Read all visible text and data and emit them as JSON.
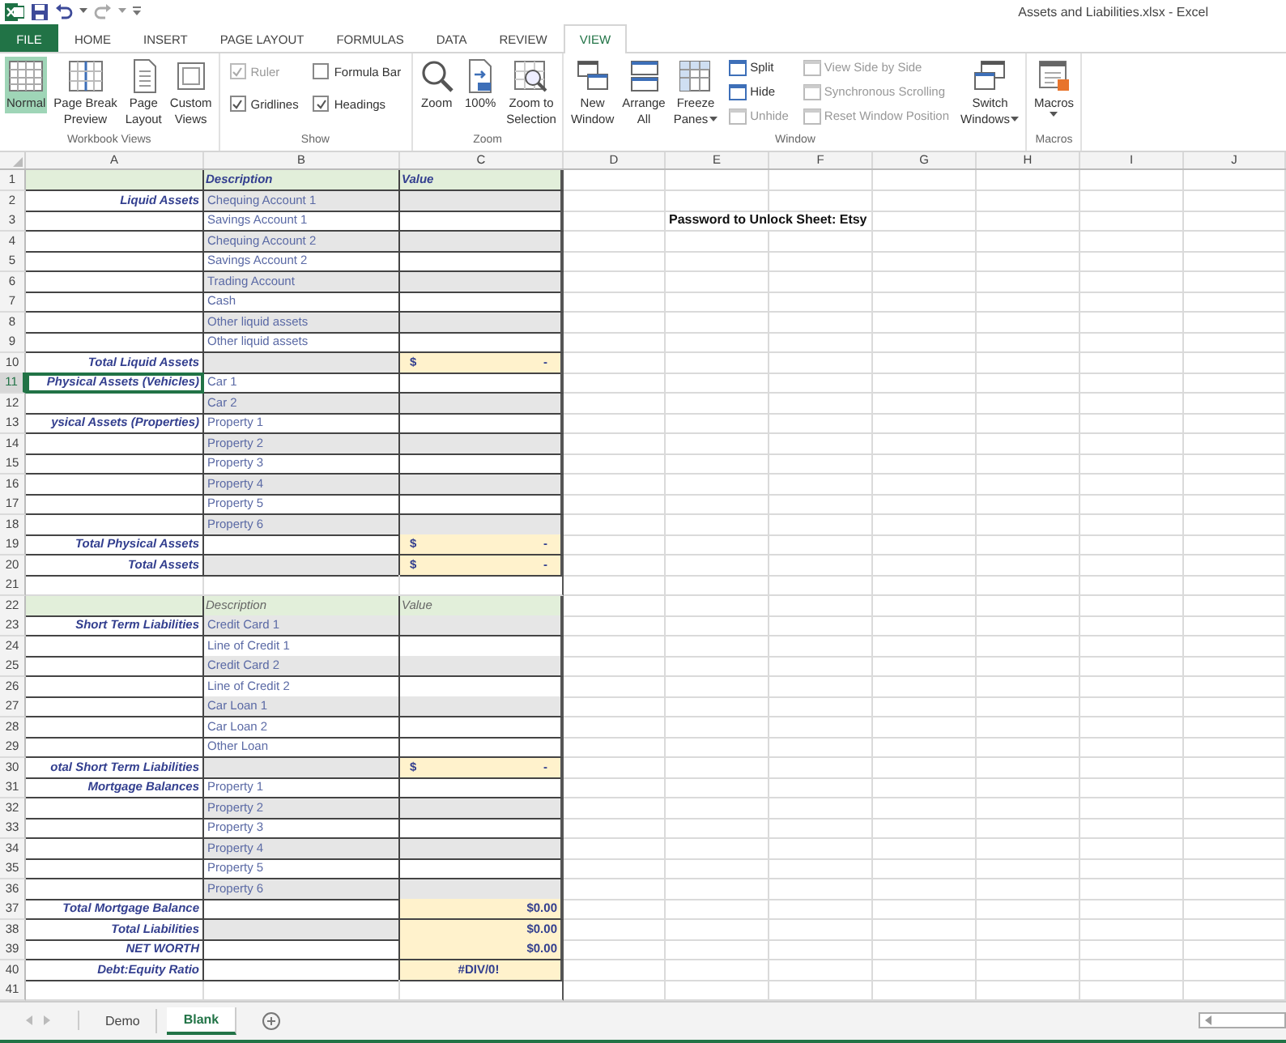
{
  "window": {
    "title": "Assets and Liabilities.xlsx - Excel"
  },
  "tabs": [
    {
      "label": "FILE",
      "kind": "file",
      "selected": false
    },
    {
      "label": "HOME",
      "kind": "tab",
      "selected": false
    },
    {
      "label": "INSERT",
      "kind": "tab",
      "selected": false
    },
    {
      "label": "PAGE LAYOUT",
      "kind": "tab",
      "selected": false
    },
    {
      "label": "FORMULAS",
      "kind": "tab",
      "selected": false
    },
    {
      "label": "DATA",
      "kind": "tab",
      "selected": false
    },
    {
      "label": "REVIEW",
      "kind": "tab",
      "selected": false
    },
    {
      "label": "VIEW",
      "kind": "tab",
      "selected": true
    }
  ],
  "ribbon": {
    "groups": [
      {
        "label": "Workbook Views",
        "items": [
          {
            "kind": "large",
            "lines": [
              "Normal"
            ],
            "selected": true
          },
          {
            "kind": "large",
            "lines": [
              "Page Break",
              "Preview"
            ],
            "selected": false
          },
          {
            "kind": "large",
            "lines": [
              "Page",
              "Layout"
            ],
            "selected": false
          },
          {
            "kind": "large",
            "lines": [
              "Custom",
              "Views"
            ],
            "selected": false
          }
        ]
      },
      {
        "label": "Show",
        "items": [
          {
            "kind": "column",
            "items": [
              {
                "kind": "checkbox",
                "label": "Ruler",
                "checked": true,
                "disabled": true
              },
              {
                "kind": "checkbox",
                "label": "Gridlines",
                "checked": true,
                "disabled": false
              }
            ]
          },
          {
            "kind": "column",
            "items": [
              {
                "kind": "checkbox",
                "label": "Formula Bar",
                "checked": false,
                "disabled": false
              },
              {
                "kind": "checkbox",
                "label": "Headings",
                "checked": true,
                "disabled": false
              }
            ]
          }
        ]
      },
      {
        "label": "Zoom",
        "items": [
          {
            "kind": "large",
            "lines": [
              "Zoom"
            ]
          },
          {
            "kind": "large",
            "lines": [
              "100%"
            ]
          },
          {
            "kind": "large",
            "lines": [
              "Zoom to",
              "Selection"
            ]
          }
        ]
      },
      {
        "label": "Window",
        "items": [
          {
            "kind": "large",
            "lines": [
              "New",
              "Window"
            ]
          },
          {
            "kind": "large",
            "lines": [
              "Arrange",
              "All"
            ]
          },
          {
            "kind": "large",
            "lines": [
              "Freeze",
              "Panes"
            ],
            "dropdown": true
          },
          {
            "kind": "column",
            "items": [
              {
                "kind": "small",
                "label": "Split",
                "disabled": false
              },
              {
                "kind": "small",
                "label": "Hide",
                "disabled": false
              },
              {
                "kind": "small",
                "label": "Unhide",
                "disabled": true
              }
            ]
          },
          {
            "kind": "column",
            "items": [
              {
                "kind": "small",
                "label": "View Side by Side",
                "disabled": true
              },
              {
                "kind": "small",
                "label": "Synchronous Scrolling",
                "disabled": true
              },
              {
                "kind": "small",
                "label": "Reset Window Position",
                "disabled": true
              }
            ]
          },
          {
            "kind": "large",
            "lines": [
              "Switch",
              "Windows"
            ],
            "dropdown": true
          }
        ]
      },
      {
        "label": "Macros",
        "items": [
          {
            "kind": "large",
            "lines": [
              "Macros"
            ],
            "dropdown": true
          }
        ]
      }
    ]
  },
  "columns": [
    "A",
    "B",
    "C",
    "D",
    "E",
    "F",
    "G",
    "H",
    "I",
    "J"
  ],
  "rows": [
    {
      "number": "1",
      "kind": "header",
      "description": "Description",
      "value": "Value",
      "selected": false
    },
    {
      "number": "2",
      "kind": "item",
      "label": "Liquid Assets",
      "description": "Chequing Account 1",
      "shaded": true,
      "selected": false
    },
    {
      "number": "3",
      "kind": "item",
      "description": "Savings Account 1",
      "shaded": false,
      "note": "Password to Unlock Sheet: Etsy",
      "selected": false
    },
    {
      "number": "4",
      "kind": "item",
      "description": "Chequing Account 2",
      "shaded": true,
      "selected": false
    },
    {
      "number": "5",
      "kind": "item",
      "description": "Savings Account 2",
      "shaded": false,
      "selected": false
    },
    {
      "number": "6",
      "kind": "item",
      "description": "Trading Account",
      "shaded": true,
      "selected": false
    },
    {
      "number": "7",
      "kind": "item",
      "description": "Cash",
      "shaded": false,
      "selected": false
    },
    {
      "number": "8",
      "kind": "item",
      "description": "Other liquid assets",
      "shaded": true,
      "selected": false
    },
    {
      "number": "9",
      "kind": "item",
      "description": "Other liquid assets",
      "shaded": false,
      "selected": false
    },
    {
      "number": "10",
      "kind": "total",
      "label": "Total Liquid Assets",
      "symbol": "$",
      "value": "-",
      "shaded": true,
      "selected": false
    },
    {
      "number": "11",
      "kind": "item",
      "label": "Physical Assets (Vehicles)",
      "description": "Car 1",
      "shaded": false,
      "selected": true
    },
    {
      "number": "12",
      "kind": "item",
      "description": "Car 2",
      "shaded": true,
      "selected": false
    },
    {
      "number": "13",
      "kind": "item",
      "label": "ysical Assets (Properties)",
      "description": "Property 1",
      "shaded": false,
      "selected": false
    },
    {
      "number": "14",
      "kind": "item",
      "description": "Property 2",
      "shaded": true,
      "selected": false
    },
    {
      "number": "15",
      "kind": "item",
      "description": "Property 3",
      "shaded": false,
      "selected": false
    },
    {
      "number": "16",
      "kind": "item",
      "description": "Property 4",
      "shaded": true,
      "selected": false
    },
    {
      "number": "17",
      "kind": "item",
      "description": "Property 5",
      "shaded": false,
      "selected": false
    },
    {
      "number": "18",
      "kind": "item",
      "description": "Property 6",
      "shaded": true,
      "selected": false
    },
    {
      "number": "19",
      "kind": "total",
      "label": "Total Physical Assets",
      "symbol": "$",
      "value": "-",
      "shaded": false,
      "selected": false
    },
    {
      "number": "20",
      "kind": "total",
      "label": "Total Assets",
      "symbol": "$",
      "value": "-",
      "shaded": true,
      "selected": false
    },
    {
      "number": "21",
      "kind": "blank",
      "selected": false
    },
    {
      "number": "22",
      "kind": "subheader",
      "description": "Description",
      "value": "Value",
      "selected": false
    },
    {
      "number": "23",
      "kind": "item",
      "label": "Short Term Liabilities",
      "description": "Credit Card 1",
      "shaded": true,
      "selected": false
    },
    {
      "number": "24",
      "kind": "item",
      "description": "Line of Credit 1",
      "shaded": false,
      "selected": false
    },
    {
      "number": "25",
      "kind": "item",
      "description": "Credit Card 2",
      "shaded": true,
      "selected": false
    },
    {
      "number": "26",
      "kind": "item",
      "description": "Line of Credit 2",
      "shaded": false,
      "selected": false
    },
    {
      "number": "27",
      "kind": "item",
      "description": "Car Loan 1",
      "shaded": true,
      "selected": false
    },
    {
      "number": "28",
      "kind": "item",
      "description": "Car Loan 2",
      "shaded": false,
      "selected": false
    },
    {
      "number": "29",
      "kind": "item",
      "description": "Other Loan",
      "shaded": false,
      "selected": false
    },
    {
      "number": "30",
      "kind": "total",
      "label": "otal Short Term Liabilities",
      "symbol": "$",
      "value": "-",
      "shaded": true,
      "selected": false
    },
    {
      "number": "31",
      "kind": "item",
      "label": "Mortgage Balances",
      "description": "Property 1",
      "shaded": false,
      "selected": false
    },
    {
      "number": "32",
      "kind": "item",
      "description": "Property 2",
      "shaded": true,
      "selected": false
    },
    {
      "number": "33",
      "kind": "item",
      "description": "Property 3",
      "shaded": false,
      "selected": false
    },
    {
      "number": "34",
      "kind": "item",
      "description": "Property 4",
      "shaded": true,
      "selected": false
    },
    {
      "number": "35",
      "kind": "item",
      "description": "Property 5",
      "shaded": false,
      "selected": false
    },
    {
      "number": "36",
      "kind": "item",
      "description": "Property 6",
      "shaded": true,
      "selected": false
    },
    {
      "number": "37",
      "kind": "total",
      "label": "Total Mortgage Balance",
      "value": "$0.00",
      "shaded": false,
      "selected": false
    },
    {
      "number": "38",
      "kind": "total",
      "label": "Total Liabilities",
      "value": "$0.00",
      "shaded": true,
      "selected": false
    },
    {
      "number": "39",
      "kind": "total",
      "label": "NET WORTH",
      "value": "$0.00",
      "shaded": false,
      "selected": false
    },
    {
      "number": "40",
      "kind": "ratio",
      "label": "Debt:Equity Ratio",
      "value": "#DIV/0!",
      "shaded": false,
      "selected": false
    },
    {
      "number": "41",
      "kind": "blank",
      "selected": false
    }
  ],
  "sheets": [
    {
      "label": "Demo",
      "selected": false
    },
    {
      "label": "Blank",
      "selected": true
    }
  ]
}
